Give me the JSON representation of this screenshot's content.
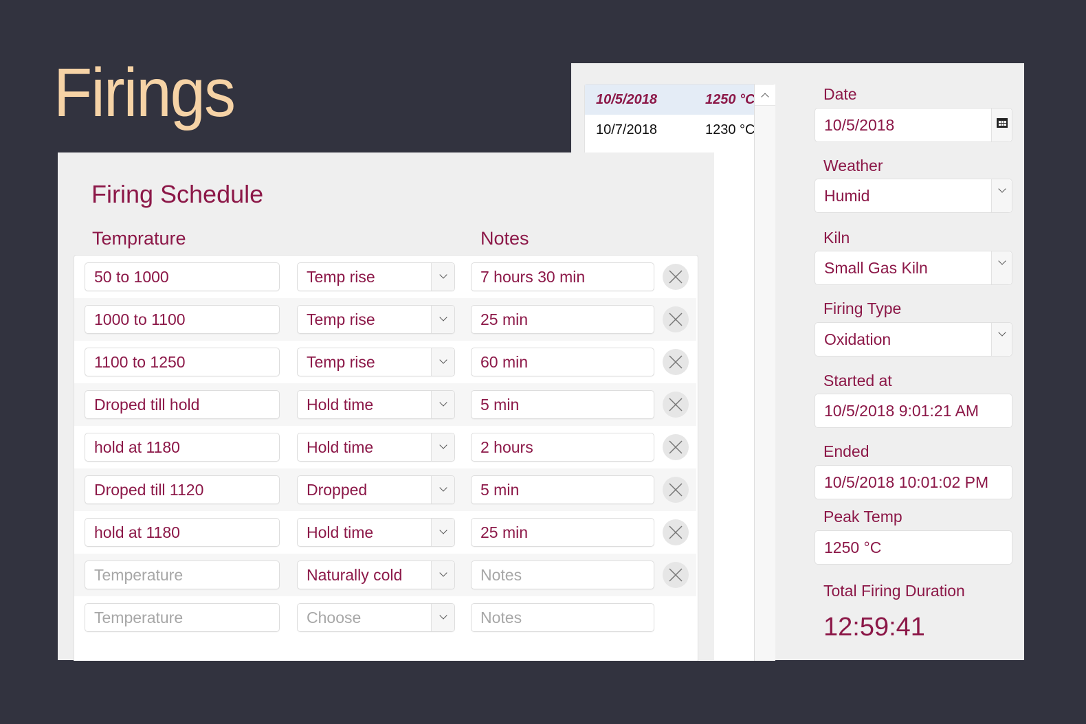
{
  "page": {
    "title": "Firings"
  },
  "firings_list": {
    "items": [
      {
        "date": "10/5/2018",
        "peak_temp": "1250 °C",
        "selected": true
      },
      {
        "date": "10/7/2018",
        "peak_temp": "1230 °C",
        "selected": false
      }
    ],
    "scroll_up_icon": "chevron-up-icon"
  },
  "details": {
    "date": {
      "label": "Date",
      "value": "10/5/2018",
      "icon": "calendar-icon"
    },
    "weather": {
      "label": "Weather",
      "value": "Humid"
    },
    "kiln": {
      "label": "Kiln",
      "value": "Small Gas Kiln"
    },
    "firing_type": {
      "label": "Firing Type",
      "value": "Oxidation"
    },
    "started_at": {
      "label": "Started at",
      "value": "10/5/2018 9:01:21 AM"
    },
    "ended": {
      "label": "Ended",
      "value": "10/5/2018 10:01:02 PM"
    },
    "peak_temp": {
      "label": "Peak Temp",
      "value": "1250 °C"
    },
    "total_duration": {
      "label": "Total Firing Duration",
      "value": "12:59:41"
    }
  },
  "schedule": {
    "title": "Firing Schedule",
    "headers": {
      "temperature": "Temprature",
      "notes": "Notes"
    },
    "placeholders": {
      "temperature": "Temperature",
      "type": "Choose",
      "notes": "Notes"
    },
    "rows": [
      {
        "temperature": "50 to 1000",
        "type": "Temp rise",
        "notes": "7 hours 30 min"
      },
      {
        "temperature": "1000 to 1100",
        "type": "Temp rise",
        "notes": "25 min"
      },
      {
        "temperature": "1100 to 1250",
        "type": "Temp rise",
        "notes": "60 min"
      },
      {
        "temperature": "Droped till hold",
        "type": "Hold time",
        "notes": "5 min"
      },
      {
        "temperature": "hold at 1180",
        "type": "Hold time",
        "notes": "2 hours"
      },
      {
        "temperature": "Droped till 1120",
        "type": "Dropped",
        "notes": "5 min"
      },
      {
        "temperature": "hold at 1180",
        "type": "Hold time",
        "notes": "25 min"
      },
      {
        "temperature": "",
        "type": "Naturally cold",
        "notes": ""
      },
      {
        "temperature": "",
        "type": "",
        "notes": ""
      }
    ]
  },
  "colors": {
    "background": "#32333f",
    "title": "#f6d3a6",
    "accent": "#8c1848",
    "panel": "#efefef"
  }
}
